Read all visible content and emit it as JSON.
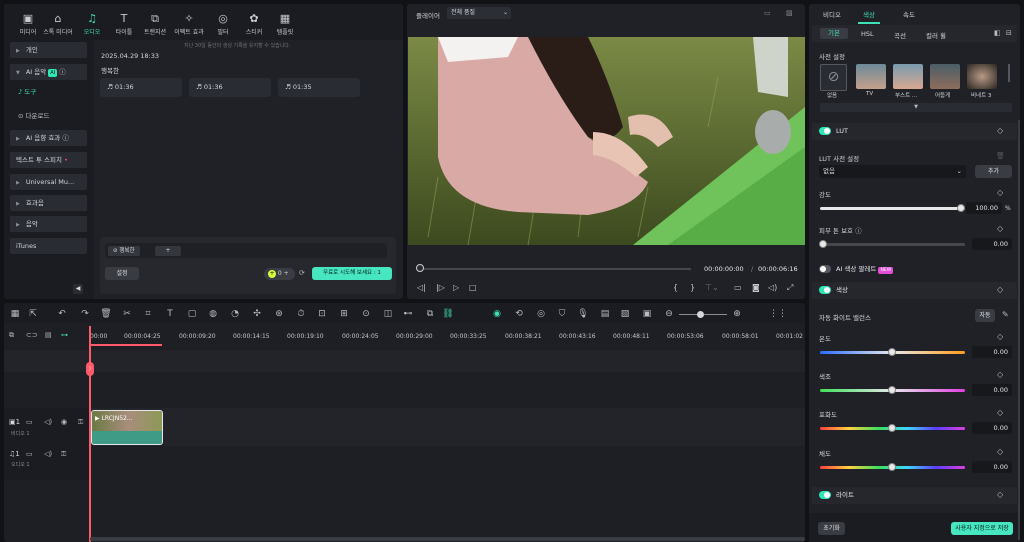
{
  "toolbar": {
    "items": [
      {
        "label": "미디어",
        "icon": "media-icon"
      },
      {
        "label": "스톡 미디어",
        "icon": "stock-media-icon"
      },
      {
        "label": "오디오",
        "icon": "audio-icon"
      },
      {
        "label": "타이틀",
        "icon": "title-icon"
      },
      {
        "label": "트랜지션",
        "icon": "transition-icon"
      },
      {
        "label": "이펙트 효과",
        "icon": "effects-icon"
      },
      {
        "label": "필터",
        "icon": "filter-icon"
      },
      {
        "label": "스티커",
        "icon": "sticker-icon"
      },
      {
        "label": "템플릿",
        "icon": "template-icon"
      }
    ],
    "active": "오디오"
  },
  "sidebar": {
    "items": [
      "개인",
      "AI 음악",
      "도구",
      "다운로드",
      "AI 음향 효과",
      "텍스트 투 스피치",
      "Universal Mu...",
      "효과음",
      "음악",
      "iTunes"
    ],
    "ai_badge": "AI"
  },
  "library": {
    "notice": "지난 30일 동안의 생성 기록을 유지할 수 있습니다.",
    "date": "2025.04.29 18:33",
    "group": "행복한",
    "cards": [
      "01:36",
      "01:36",
      "01:35"
    ],
    "prompt_chip": "행복한",
    "add_chip": "+",
    "settings_button": "설정",
    "credits": "0",
    "try_button": "무료로 시도해 보세요 : 1"
  },
  "player": {
    "label": "플레이어",
    "quality": "전체 품질",
    "current_time": "00:00:00:00",
    "separator": "/",
    "total_time": "00:00:06:16"
  },
  "timeline": {
    "ruler": [
      "00:00",
      "00:00:04:25",
      "00:00:09:20",
      "00:00:14:15",
      "00:00:19:10",
      "00:00:24:05",
      "00:00:29:00",
      "00:00:33:25",
      "00:00:38:21",
      "00:00:43:16",
      "00:00:48:11",
      "00:00:53:06",
      "00:00:58:01",
      "00:01:02"
    ],
    "video_track": {
      "number": "1",
      "label": "비디오 1"
    },
    "audio_track": {
      "number": "1",
      "label": "오디오 1"
    },
    "clip_label": "LRCJN52..."
  },
  "right_panel": {
    "tabs": [
      "비디오",
      "색상",
      "속도"
    ],
    "active_tab": "색상",
    "subtabs": [
      "기본",
      "HSL",
      "곡선",
      "컬러 휠"
    ],
    "presets_title": "사전 설정",
    "presets": [
      "없음",
      "TV",
      "부스트 ...",
      "어둡게",
      "비네트 3"
    ],
    "lut": {
      "title": "LUT",
      "preset_label": "LUT 사전 설정",
      "preset_value": "없음",
      "add_button": "추가",
      "strength_label": "강도",
      "strength_value": "100.00",
      "strength_unit": "%",
      "skin_label": "피부 톤 보호",
      "skin_value": "0.00"
    },
    "ai_palette": {
      "title": "AI 색상 팔레트",
      "badge": "NEW"
    },
    "color": {
      "title": "색상",
      "wb_label": "자동 화이트 밸런스",
      "auto_button": "자동",
      "sliders": [
        {
          "label": "온도",
          "value": "0.00"
        },
        {
          "label": "색조",
          "value": "0.00"
        },
        {
          "label": "포화도",
          "value": "0.00"
        },
        {
          "label": "채도",
          "value": "0.00"
        }
      ]
    },
    "light_title": "라이트",
    "reset_button": "초기화",
    "save_button": "사용자 지정으로 저장"
  }
}
